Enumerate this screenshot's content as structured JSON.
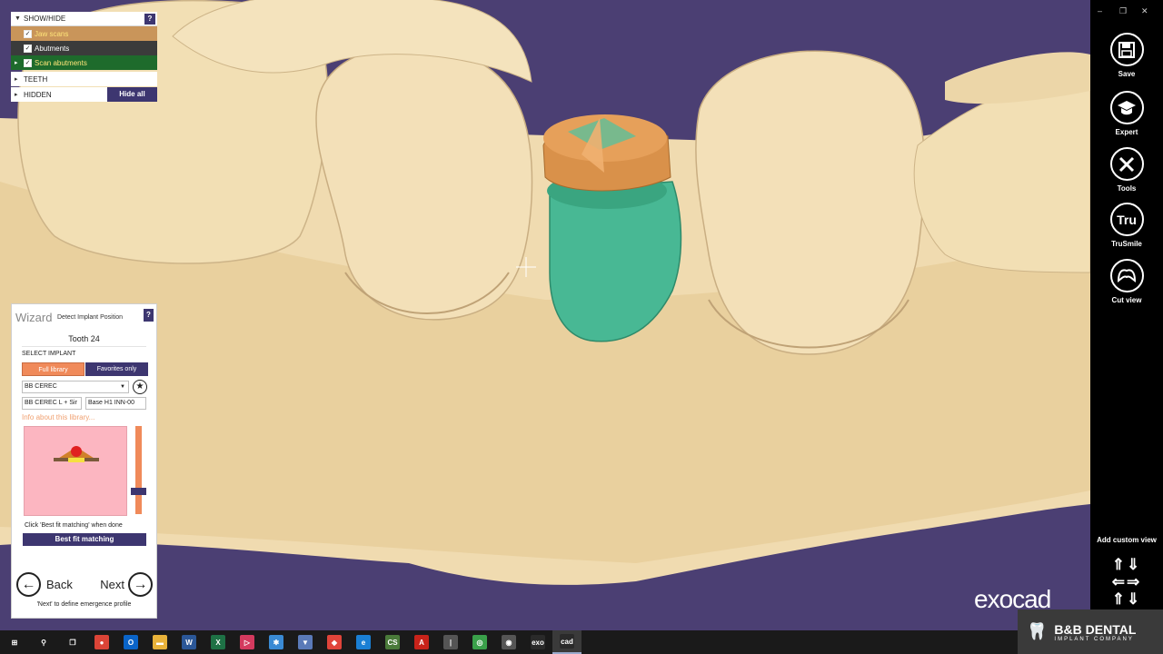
{
  "show_hide": {
    "header": "SHOW/HIDE",
    "help": "?",
    "items": [
      {
        "label": "Jaw scans",
        "checked": true
      },
      {
        "label": "Abutments",
        "checked": true
      },
      {
        "label": "Scan abutments",
        "checked": true
      }
    ],
    "teeth": "TEETH",
    "hidden": "HIDDEN",
    "hide_all": "Hide all"
  },
  "wizard": {
    "title": "Wizard",
    "step": "Detect Implant Position",
    "help": "?",
    "tooth": "Tooth 24",
    "select_label": "SELECT IMPLANT",
    "full_library": "Full library",
    "favorites_only": "Favorites only",
    "library_select": "BB CEREC",
    "type_select": "BB CEREC L + Sir",
    "base_select": "Base H1 INN-00",
    "info_link": "Info about this library...",
    "hint": "Click 'Best fit matching' when done",
    "best_fit": "Best fit matching",
    "back": "Back",
    "next": "Next",
    "footnote": "'Next' to define emergence profile"
  },
  "toolbar": {
    "items": [
      {
        "label": "Save",
        "icon": "save-icon"
      },
      {
        "label": "Expert",
        "icon": "graduation-cap-icon"
      },
      {
        "label": "Tools",
        "icon": "tools-icon"
      },
      {
        "label": "TruSmile",
        "icon": "trusmile-icon",
        "glyph": "Tru"
      },
      {
        "label": "Cut view",
        "icon": "tooth-cut-icon"
      }
    ],
    "add_custom_view": "Add custom view",
    "window_controls": [
      "–",
      "❐",
      "✕"
    ]
  },
  "branding": {
    "exocad": "exocad",
    "bb_name": "B&B DENTAL",
    "bb_sub": "IMPLANT COMPANY"
  },
  "taskbar": {
    "apps": [
      {
        "name": "start",
        "glyph": "⊞",
        "color": "#1a1a1a"
      },
      {
        "name": "search",
        "glyph": "⚲",
        "color": "#1a1a1a"
      },
      {
        "name": "task-view",
        "glyph": "❐",
        "color": "#1a1a1a"
      },
      {
        "name": "chrome",
        "glyph": "●",
        "color": "#db4437"
      },
      {
        "name": "outlook",
        "glyph": "O",
        "color": "#0a64c8"
      },
      {
        "name": "explorer",
        "glyph": "▬",
        "color": "#e8b23a"
      },
      {
        "name": "word",
        "glyph": "W",
        "color": "#2b5797"
      },
      {
        "name": "excel",
        "glyph": "X",
        "color": "#1e7145"
      },
      {
        "name": "app-triangle",
        "glyph": "▷",
        "color": "#d43a5e"
      },
      {
        "name": "app-blue",
        "glyph": "✱",
        "color": "#3a8ad4"
      },
      {
        "name": "app-install",
        "glyph": "▼",
        "color": "#5a7ab8"
      },
      {
        "name": "anydesk",
        "glyph": "◆",
        "color": "#e0443a"
      },
      {
        "name": "edge",
        "glyph": "e",
        "color": "#1a7fd4"
      },
      {
        "name": "cs",
        "glyph": "CS",
        "color": "#4a7a3a"
      },
      {
        "name": "acrobat",
        "glyph": "A",
        "color": "#c8231a"
      },
      {
        "name": "tool",
        "glyph": "|",
        "color": "#555555"
      },
      {
        "name": "app-green",
        "glyph": "◎",
        "color": "#3aa04a"
      },
      {
        "name": "app-circle",
        "glyph": "◉",
        "color": "#555555"
      },
      {
        "name": "exo",
        "glyph": "exo",
        "color": "#2a2a2a"
      },
      {
        "name": "cad",
        "glyph": "cad",
        "color": "#2a2a2a"
      }
    ]
  }
}
